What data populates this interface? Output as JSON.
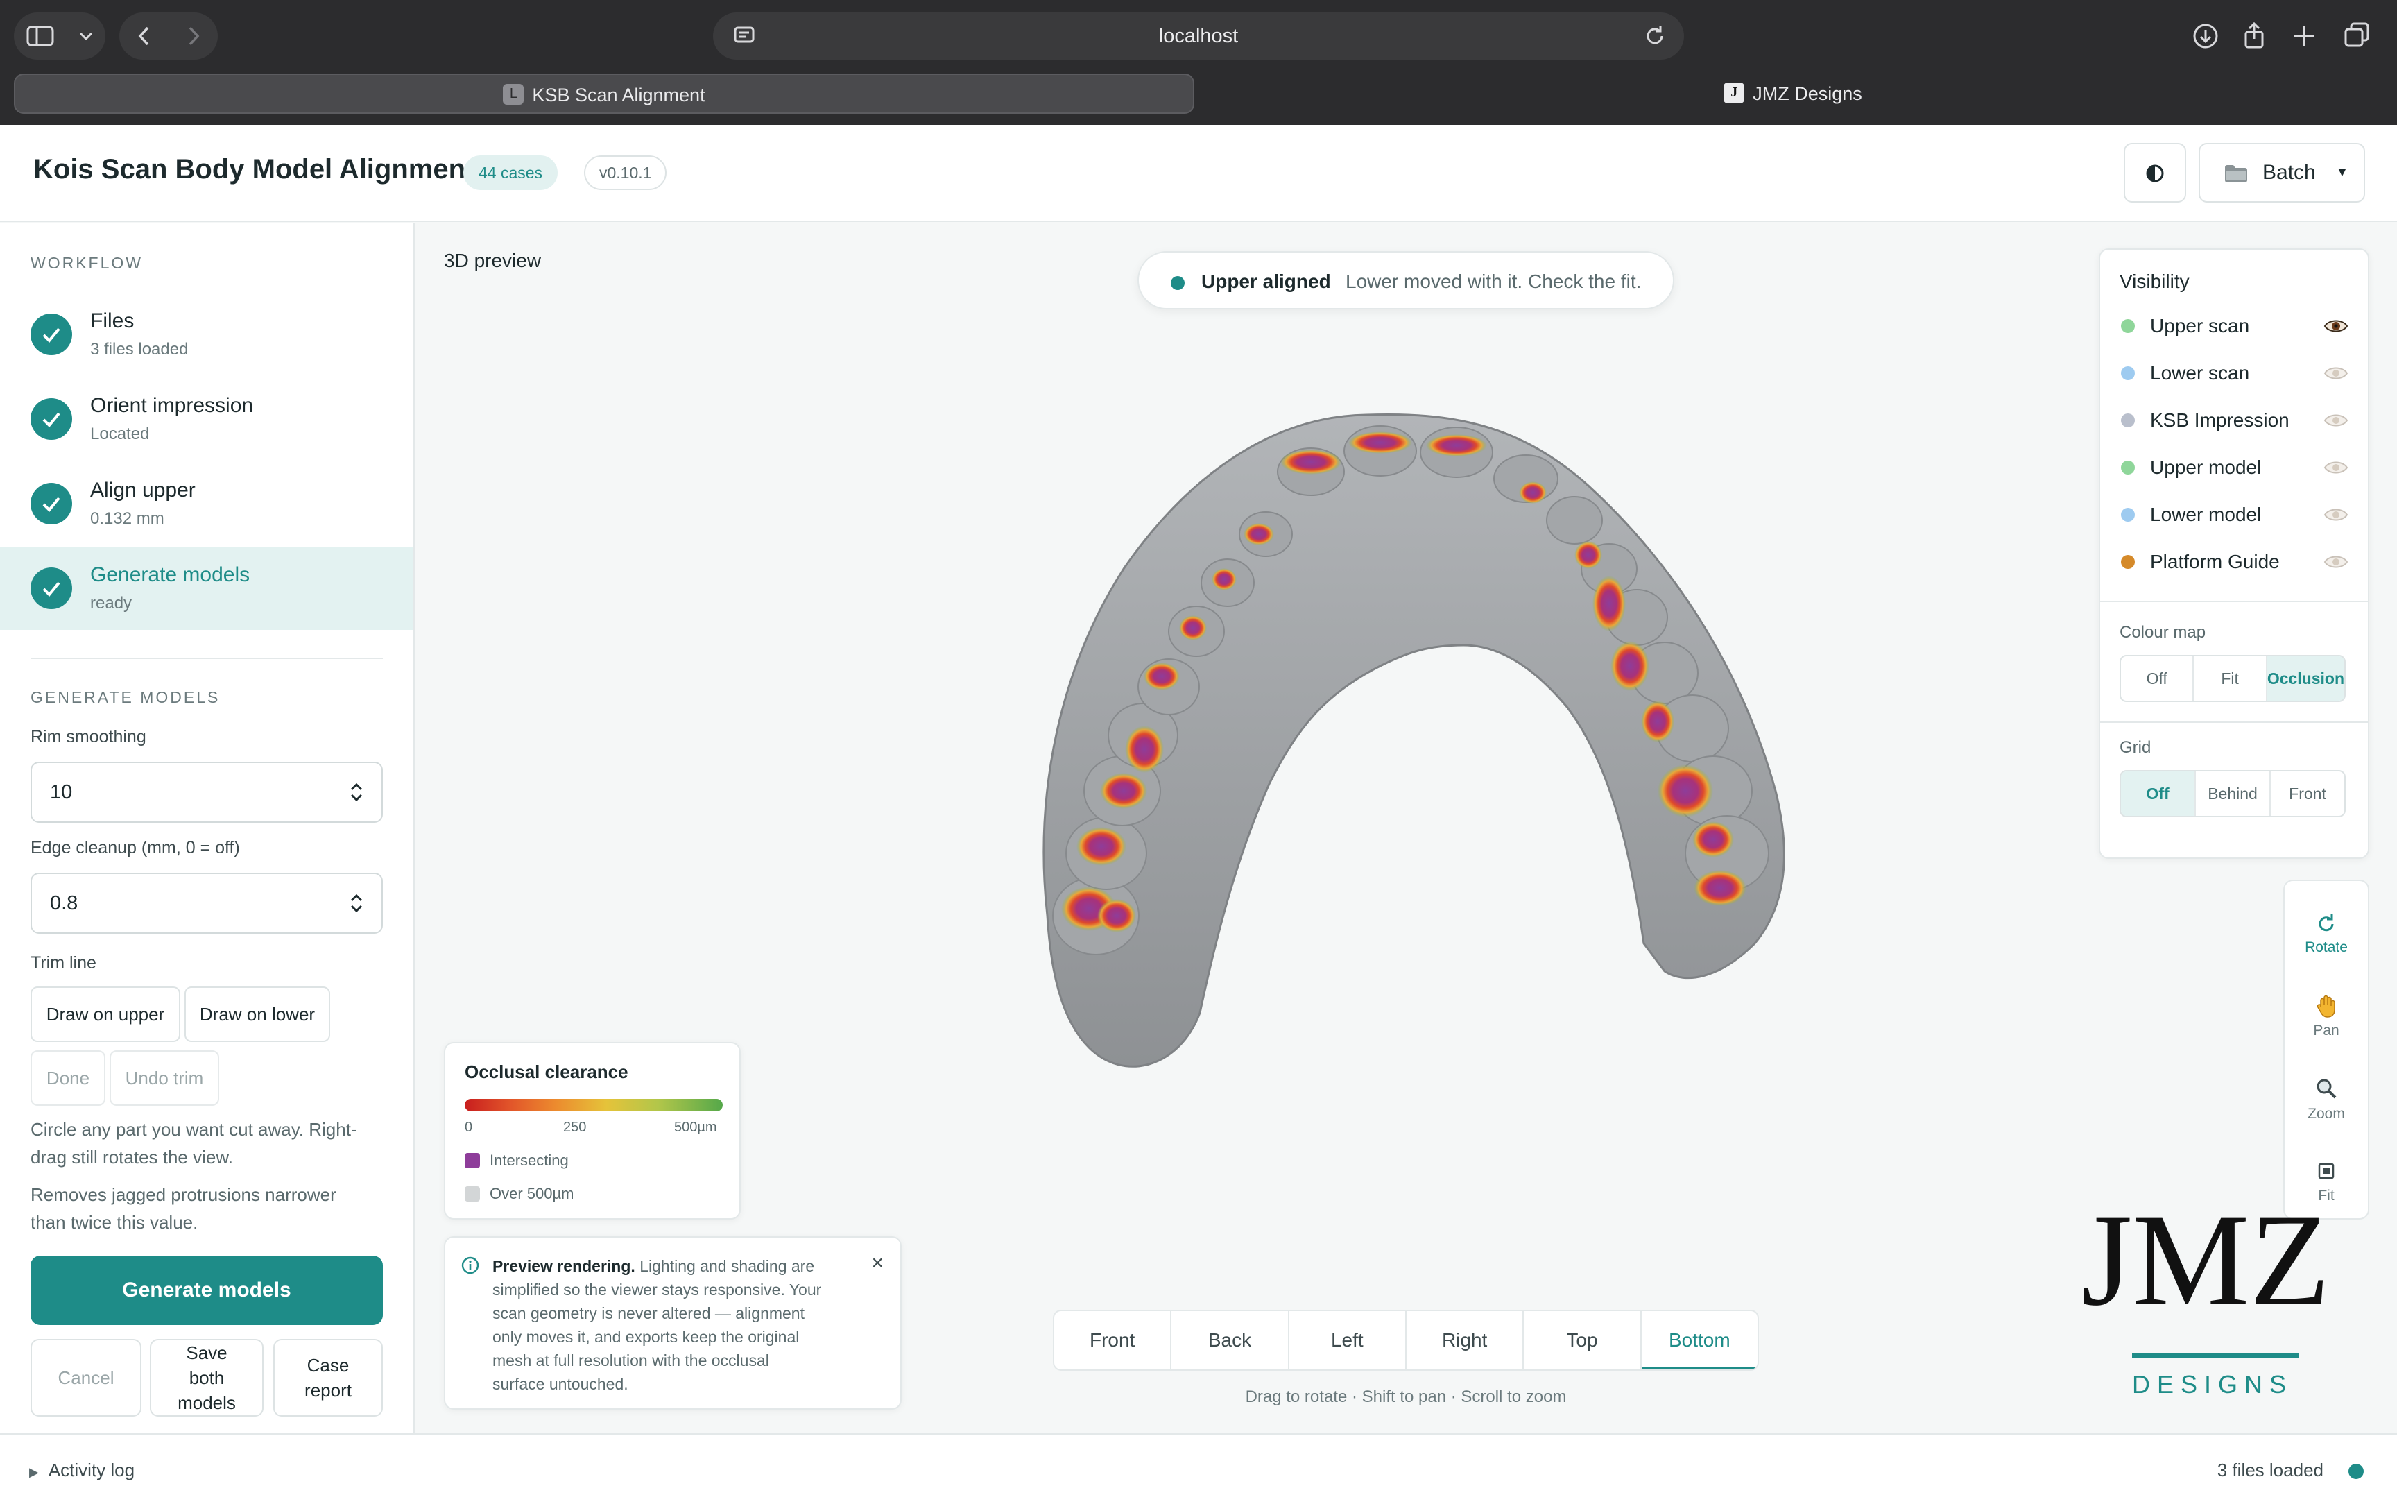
{
  "browser": {
    "url": "localhost",
    "tabs": [
      {
        "favicon": "L",
        "label": "KSB Scan Alignment",
        "active": true
      },
      {
        "favicon": "J",
        "label": "JMZ Designs",
        "active": false
      }
    ],
    "icons": [
      "sidebar-toggle-icon",
      "chevron-down-icon",
      "back-icon",
      "forward-icon",
      "site-settings-icon",
      "reload-icon",
      "download-icon",
      "share-icon",
      "new-tab-icon",
      "tab-overview-icon"
    ]
  },
  "header": {
    "title": "Kois Scan Body Model Alignment",
    "cases_badge": "44 cases",
    "version_badge": "v0.10.1",
    "batch_label": "Batch"
  },
  "sidebar": {
    "workflow_label": "WORKFLOW",
    "steps": [
      {
        "title": "Files",
        "sub": "3 files loaded"
      },
      {
        "title": "Orient impression",
        "sub": "Located"
      },
      {
        "title": "Align upper",
        "sub": "0.132 mm"
      },
      {
        "title": "Generate models",
        "sub": "ready",
        "active": true
      }
    ],
    "generate_label": "GENERATE MODELS",
    "rim_label": "Rim smoothing",
    "rim_value": "10",
    "edge_label": "Edge cleanup (mm, 0 = off)",
    "edge_value": "0.8",
    "trim_label": "Trim line",
    "draw_upper": "Draw on upper",
    "draw_lower": "Draw on lower",
    "done": "Done",
    "undo_trim": "Undo trim",
    "help1_line1": "Circle any part you want cut away. Right-",
    "help1_line2": "drag still rotates the view.",
    "help2_line1": "Removes jagged protrusions narrower",
    "help2_line2": "than twice this value.",
    "generate_button": "Generate models",
    "cancel": "Cancel",
    "save_line1": "Save",
    "save_line2": "both",
    "save_line3": "models",
    "report_line1": "Case",
    "report_line2": "report"
  },
  "preview": {
    "label": "3D preview",
    "toast_title": "Upper aligned",
    "toast_msg": "Lower moved with it. Check the fit.",
    "legend": {
      "title": "Occlusal clearance",
      "ticks": [
        "0",
        "250",
        "500µm"
      ],
      "intersecting": "Intersecting",
      "over": "Over 500µm",
      "colors": {
        "intersecting": "#8e3d9a",
        "over": "#d3d6d7"
      }
    },
    "info": {
      "bold": "Preview rendering.",
      "line1": "Lighting and shading are",
      "line2": "simplified so the viewer stays responsive. Your",
      "line3": "scan geometry is never altered — alignment",
      "line4": "only moves it, and exports keep the original",
      "line5": "mesh at full resolution with the occlusal",
      "line6": "surface untouched."
    },
    "views": [
      "Front",
      "Back",
      "Left",
      "Right",
      "Top",
      "Bottom"
    ],
    "active_view": "Bottom",
    "hint": "Drag to rotate · Shift to pan · Scroll to zoom"
  },
  "visibility": {
    "title": "Visibility",
    "items": [
      {
        "label": "Upper scan",
        "color": "#8fd69a",
        "visible": true
      },
      {
        "label": "Lower scan",
        "color": "#9ecbf0",
        "visible": false
      },
      {
        "label": "KSB Impression",
        "color": "#b9bfcc",
        "visible": false
      },
      {
        "label": "Upper model",
        "color": "#8fd69a",
        "visible": false
      },
      {
        "label": "Lower model",
        "color": "#9ecbf0",
        "visible": false
      },
      {
        "label": "Platform Guide",
        "color": "#d58a2a",
        "visible": false
      }
    ],
    "colour_map_label": "Colour map",
    "colour_map_options": [
      "Off",
      "Fit",
      "Occlusion"
    ],
    "colour_map_active": "Occlusion",
    "grid_label": "Grid",
    "grid_options": [
      "Off",
      "Behind",
      "Front"
    ],
    "grid_active": "Off"
  },
  "tools": [
    {
      "label": "Rotate",
      "icon": "rotate-icon",
      "active": true
    },
    {
      "label": "Pan",
      "icon": "hand-icon",
      "active": false
    },
    {
      "label": "Zoom",
      "icon": "magnifier-icon",
      "active": false
    },
    {
      "label": "Fit",
      "icon": "fit-icon",
      "active": false
    }
  ],
  "logo": {
    "main": "JMZ",
    "sub": "DESIGNS"
  },
  "status": {
    "activity": "Activity log",
    "files": "3 files loaded"
  },
  "colors": {
    "accent": "#1e8c88",
    "accent_light": "#e3f2f1"
  }
}
